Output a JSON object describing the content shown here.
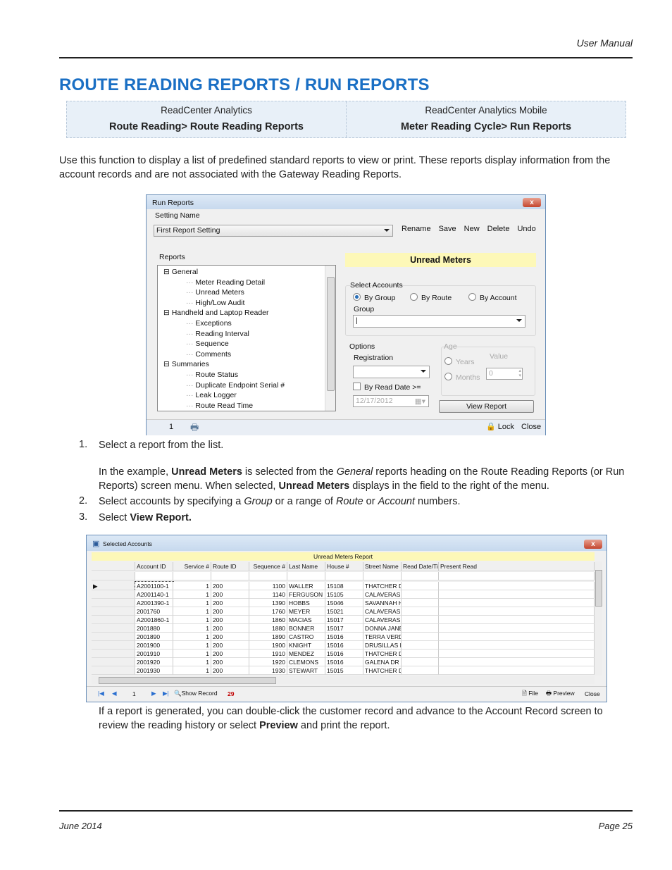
{
  "header": {
    "doc_label": "User Manual"
  },
  "title": "ROUTE READING REPORTS / RUN REPORTS",
  "nav_table": [
    {
      "product": "ReadCenter Analytics",
      "path": "Route Reading> Route Reading Reports"
    },
    {
      "product": "ReadCenter Analytics Mobile",
      "path": "Meter Reading Cycle> Run Reports"
    }
  ],
  "intro": "Use this function to display a list of predefined standard reports to view or print. These reports display information from the account records and are not associated with the Gateway Reading Reports.",
  "run_reports": {
    "title": "Run Reports",
    "close": "x",
    "setting_name_label": "Setting Name",
    "setting_value": "First Report Setting",
    "toolbar": [
      "Rename",
      "Save",
      "New",
      "Delete",
      "Undo"
    ],
    "reports_label": "Reports",
    "tree": [
      {
        "label": "General",
        "level": 0
      },
      {
        "label": "Meter Reading Detail",
        "level": 1
      },
      {
        "label": "Unread Meters",
        "level": 1
      },
      {
        "label": "High/Low Audit",
        "level": 1
      },
      {
        "label": "Handheld and Laptop Reader",
        "level": 0
      },
      {
        "label": "Exceptions",
        "level": 1
      },
      {
        "label": "Reading Interval",
        "level": 1
      },
      {
        "label": "Sequence",
        "level": 1
      },
      {
        "label": "Comments",
        "level": 1
      },
      {
        "label": "Summaries",
        "level": 0
      },
      {
        "label": "Route Status",
        "level": 1
      },
      {
        "label": "Duplicate Endpoint Serial #",
        "level": 1
      },
      {
        "label": "Leak Logger",
        "level": 1
      },
      {
        "label": "Route Read Time",
        "level": 1
      }
    ],
    "selected_report": "Unread Meters",
    "select_accounts_label": "Select Accounts",
    "radios": [
      {
        "label": "By Group",
        "checked": true
      },
      {
        "label": "By Route",
        "checked": false
      },
      {
        "label": "By Account",
        "checked": false
      }
    ],
    "group_label": "Group",
    "group_value": "",
    "options_label": "Options",
    "registration_label": "Registration",
    "registration_value": "",
    "by_read_date_label": "By Read Date >=",
    "by_read_date_checked": false,
    "date_value": "12/17/2012",
    "age_label": "Age",
    "years_label": "Years",
    "months_label": "Months",
    "value_label": "Value",
    "value": "0",
    "view_report": "View Report",
    "status_page": "1",
    "lock": "Lock",
    "close_label": "Close"
  },
  "steps": [
    {
      "num": "1.",
      "text": "Select a report from the list."
    },
    {
      "num": "2.",
      "text": "Select accounts by specifying a Group or a range of Route or Account numbers."
    },
    {
      "num": "3.",
      "text": "Select View Report."
    }
  ],
  "example_text": {
    "p1": "In the example, ",
    "b1": "Unread Meters",
    "p2": " is selected from the ",
    "i1": "General",
    "p3": " reports heading on the Route Reading Reports (or Run Reports) screen menu. When selected, ",
    "b2": "Unread Meters",
    "p4": " displays in the field to the right of the menu."
  },
  "step2": {
    "a": "Select accounts by specifying a ",
    "i1": "Group",
    "b": " or a range of ",
    "i2": "Route",
    "c": " or ",
    "i3": "Account",
    "d": " numbers."
  },
  "step3": {
    "a": "Select ",
    "b": "View Report."
  },
  "selected_accounts": {
    "title": "Selected Accounts",
    "report_title": "Unread Meters Report",
    "columns": [
      "Account ID",
      "Service #",
      "Route ID",
      "Sequence #",
      "Last Name",
      "House #",
      "Street Name",
      "Read Date/Time",
      "Present Read"
    ],
    "rows": [
      [
        "A2001100-1",
        "1",
        "200",
        "1100",
        "WALLER",
        "15108",
        "THATCHER DR",
        "",
        ""
      ],
      [
        "A2001140-1",
        "1",
        "200",
        "1140",
        "FERGUSON",
        "15105",
        "CALAVERAS DR",
        "",
        ""
      ],
      [
        "A2001390-1",
        "1",
        "200",
        "1390",
        "HOBBS",
        "15046",
        "SAVANNAH HEIG",
        "",
        ""
      ],
      [
        "2001760",
        "1",
        "200",
        "1760",
        "MEYER",
        "15021",
        "CALAVERAS DR",
        "",
        ""
      ],
      [
        "A2001860-1",
        "1",
        "200",
        "1860",
        "MACIAS",
        "15017",
        "CALAVERAS DR",
        "",
        ""
      ],
      [
        "2001880",
        "1",
        "200",
        "1880",
        "BONNER",
        "15017",
        "DONNA JANE LO",
        "",
        ""
      ],
      [
        "2001890",
        "1",
        "200",
        "1890",
        "CASTRO",
        "15016",
        "TERRA VERDE D",
        "",
        ""
      ],
      [
        "2001900",
        "1",
        "200",
        "1900",
        "KNIGHT",
        "15016",
        "DRUSILLAS DR",
        "",
        ""
      ],
      [
        "2001910",
        "1",
        "200",
        "1910",
        "MENDEZ",
        "15016",
        "THATCHER DR",
        "",
        ""
      ],
      [
        "2001920",
        "1",
        "200",
        "1920",
        "CLEMONS",
        "15016",
        "GALENA DR",
        "",
        ""
      ],
      [
        "2001930",
        "1",
        "200",
        "1930",
        "STEWART",
        "15015",
        "THATCHER DR",
        "",
        ""
      ]
    ],
    "nav_position": "1",
    "show_record": "Show Record",
    "record_count": "29",
    "file": "File",
    "preview": "Preview",
    "close": "Close"
  },
  "after_text": {
    "a": "If a report is generated, you can double-click the customer record and advance to the Account Record screen to review the reading history or select ",
    "b": "Preview",
    "c": " and print the report."
  },
  "footer": {
    "date": "June 2014",
    "page": "Page 25"
  },
  "colors": {
    "title": "#1a6fc4",
    "banner": "#fdf8b8",
    "count": "#c00000"
  }
}
